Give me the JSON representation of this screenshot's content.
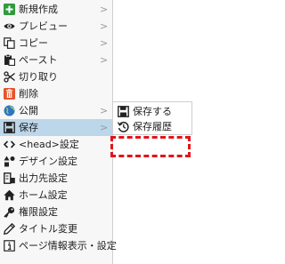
{
  "menu": {
    "items": [
      {
        "label": "新規作成",
        "icon": "plus-square-icon",
        "submenu": true
      },
      {
        "label": "プレビュー",
        "icon": "eye-icon",
        "submenu": true
      },
      {
        "label": "コピー",
        "icon": "copy-icon",
        "submenu": true
      },
      {
        "label": "ペースト",
        "icon": "paste-icon",
        "submenu": true
      },
      {
        "label": "切り取り",
        "icon": "scissors-icon",
        "submenu": false
      },
      {
        "label": "削除",
        "icon": "trash-icon",
        "submenu": false
      },
      {
        "label": "公開",
        "icon": "globe-icon",
        "submenu": true
      },
      {
        "label": "保存",
        "icon": "floppy-disk-icon",
        "submenu": true,
        "active": true
      },
      {
        "label": "<head>設定",
        "icon": "code-icon",
        "submenu": false
      },
      {
        "label": "デザイン設定",
        "icon": "shapes-icon",
        "submenu": false
      },
      {
        "label": "出力先設定",
        "icon": "output-icon",
        "submenu": false
      },
      {
        "label": "ホーム設定",
        "icon": "home-icon",
        "submenu": false
      },
      {
        "label": "権限設定",
        "icon": "key-icon",
        "submenu": false
      },
      {
        "label": "タイトル変更",
        "icon": "pencil-icon",
        "submenu": false
      },
      {
        "label": "ページ情報表示・設定",
        "icon": "info-icon",
        "submenu": false
      }
    ],
    "chevron": ">"
  },
  "submenu": {
    "items": [
      {
        "label": "保存する",
        "icon": "floppy-disk-icon"
      },
      {
        "label": "保存履歴",
        "icon": "history-icon"
      }
    ]
  },
  "colors": {
    "active_background": "#bcd6ea",
    "highlight_border": "#e0151a",
    "new_icon": "#2e9b3d",
    "delete_icon": "#e8542b",
    "globe_icon": "#2a74c4"
  }
}
